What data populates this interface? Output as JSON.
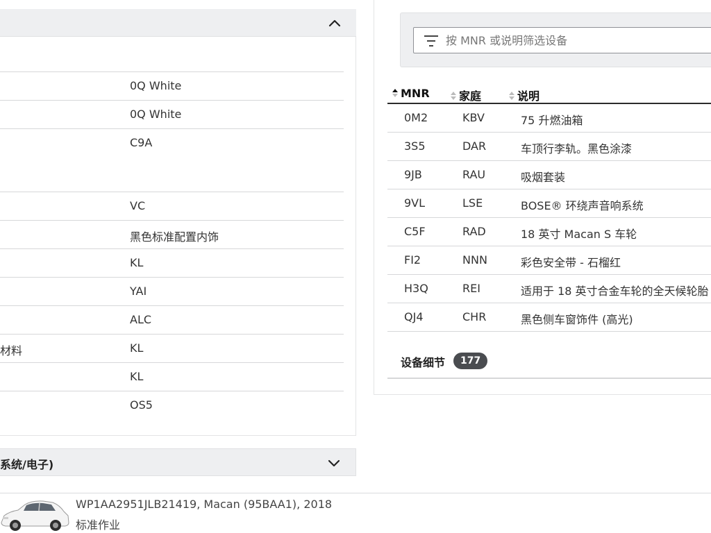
{
  "vehicle_section": {
    "attributes": [
      {
        "label": "",
        "value": "0Q White"
      },
      {
        "label": "",
        "value": "0Q White"
      },
      {
        "label": "",
        "value": "C9A"
      },
      {
        "label": "",
        "value": "VC"
      },
      {
        "label": "",
        "value": "黑色标准配置内饰"
      },
      {
        "label": "",
        "value": "KL"
      },
      {
        "label": "",
        "value": "YAI"
      },
      {
        "label": "",
        "value": "ALC"
      },
      {
        "label": "材料",
        "value": "KL"
      },
      {
        "label": "",
        "value": "KL"
      },
      {
        "label": "",
        "value": "OS5"
      }
    ]
  },
  "second_section": {
    "title": "系统/电子)"
  },
  "equipment": {
    "filter": {
      "placeholder": "按 MNR 或说明筛选设备"
    },
    "columns": {
      "mnr": "MNR",
      "family": "家庭",
      "description": "说明"
    },
    "rows": [
      {
        "mnr": "0M2",
        "family": "KBV",
        "description": "75 升燃油箱"
      },
      {
        "mnr": "3S5",
        "family": "DAR",
        "description": "车顶行李轨。黑色涂漆"
      },
      {
        "mnr": "9JB",
        "family": "RAU",
        "description": "吸烟套装"
      },
      {
        "mnr": "9VL",
        "family": "LSE",
        "description": "BOSE® 环绕声音响系统"
      },
      {
        "mnr": "C5F",
        "family": "RAD",
        "description": "18 英寸 Macan S 车轮"
      },
      {
        "mnr": "FI2",
        "family": "NNN",
        "description": "彩色安全带 - 石榴红"
      },
      {
        "mnr": "H3Q",
        "family": "REI",
        "description": "适用于 18 英寸合金车轮的全天候轮胎"
      },
      {
        "mnr": "QJ4",
        "family": "CHR",
        "description": "黑色侧车窗饰件 (高光)"
      }
    ],
    "details_label": "设备细节",
    "details_count": "177"
  },
  "bottom_bar": {
    "vehicle": "WP1AA2951JLB21419, Macan (95BAA1), 2018",
    "job": "标准作业"
  },
  "colors": {
    "header_bg": "#eeeff1",
    "badge_bg": "#4a4c50",
    "border": "#d6d7d9"
  }
}
